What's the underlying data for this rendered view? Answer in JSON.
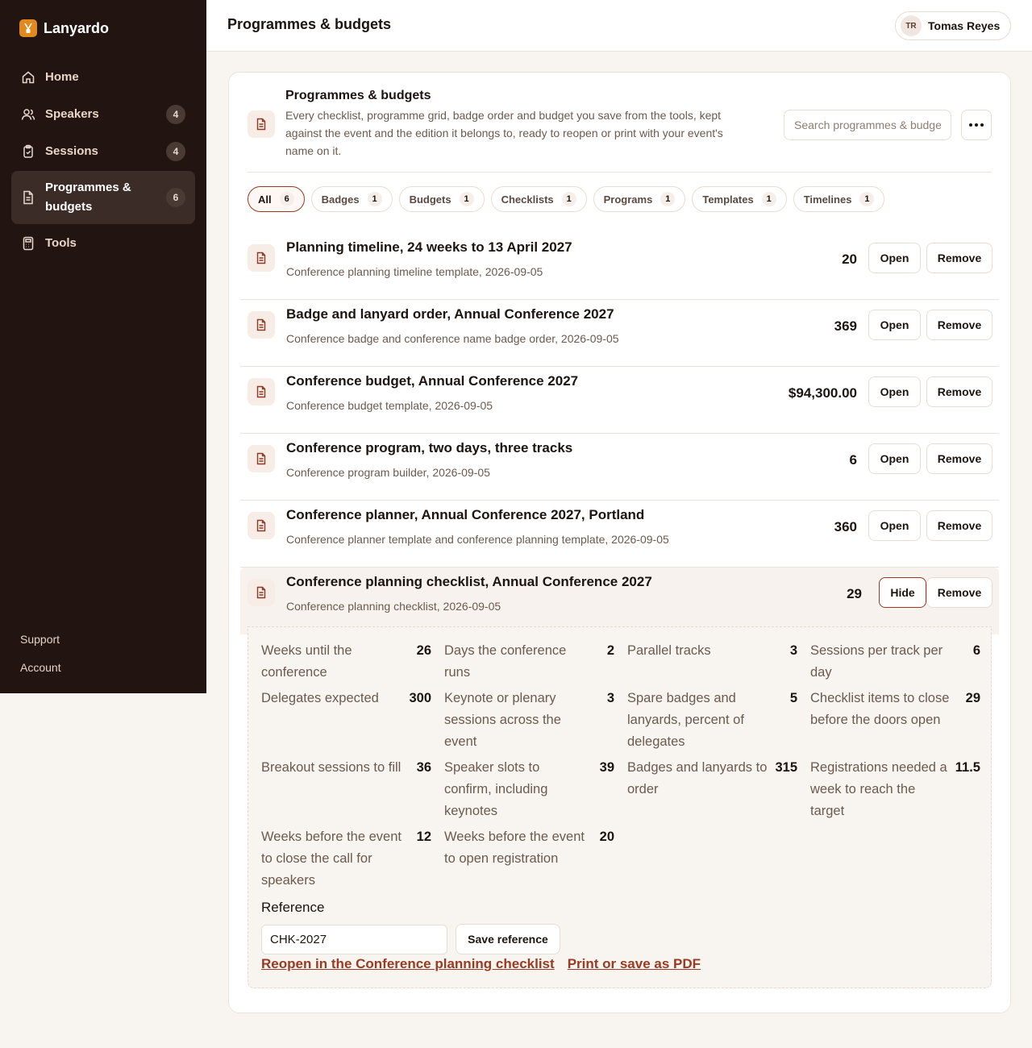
{
  "app": {
    "name": "Lanyardo"
  },
  "sidebar": {
    "items": [
      {
        "label": "Home",
        "icon": "home-icon"
      },
      {
        "label": "Speakers",
        "badge": "4",
        "icon": "users-icon"
      },
      {
        "label": "Sessions",
        "badge": "4",
        "icon": "clipboard-icon"
      },
      {
        "label": "Programmes & budgets",
        "badge": "6",
        "icon": "document-icon",
        "active": true
      },
      {
        "label": "Tools",
        "icon": "calculator-icon"
      }
    ],
    "footer": {
      "support": "Support",
      "account": "Account"
    }
  },
  "topbar": {
    "title": "Programmes & budgets",
    "user": {
      "initials": "TR",
      "name": "Tomas Reyes"
    }
  },
  "card": {
    "title": "Programmes & budgets",
    "description": "Every checklist, programme grid, badge order and budget you save from the tools, kept against the event and the edition it belongs to, ready to reopen or print with your event's name on it.",
    "search_placeholder": "Search programmes & budgets"
  },
  "filters": [
    {
      "label": "All",
      "count": "6",
      "active": true
    },
    {
      "label": "Badges",
      "count": "1"
    },
    {
      "label": "Budgets",
      "count": "1"
    },
    {
      "label": "Checklists",
      "count": "1"
    },
    {
      "label": "Programs",
      "count": "1"
    },
    {
      "label": "Templates",
      "count": "1"
    },
    {
      "label": "Timelines",
      "count": "1"
    }
  ],
  "rows": [
    {
      "title": "Planning timeline, 24 weeks to 13 April 2027",
      "subtitle": "Conference planning timeline template, 2026-09-05",
      "value": "20",
      "primary": "Open",
      "remove": "Remove"
    },
    {
      "title": "Badge and lanyard order, Annual Conference 2027",
      "subtitle": "Conference badge and conference name badge order, 2026-09-05",
      "value": "369",
      "primary": "Open",
      "remove": "Remove"
    },
    {
      "title": "Conference budget, Annual Conference 2027",
      "subtitle": "Conference budget template, 2026-09-05",
      "value": "$94,300.00",
      "primary": "Open",
      "remove": "Remove"
    },
    {
      "title": "Conference program, two days, three tracks",
      "subtitle": "Conference program builder, 2026-09-05",
      "value": "6",
      "primary": "Open",
      "remove": "Remove"
    },
    {
      "title": "Conference planner, Annual Conference 2027, Portland",
      "subtitle": "Conference planner template and conference planning template, 2026-09-05",
      "value": "360",
      "primary": "Open",
      "remove": "Remove"
    },
    {
      "title": "Conference planning checklist, Annual Conference 2027",
      "subtitle": "Conference planning checklist, 2026-09-05",
      "value": "29",
      "primary": "Hide",
      "remove": "Remove"
    }
  ],
  "detail": {
    "stats": [
      {
        "label": "Weeks until the conference",
        "value": "26"
      },
      {
        "label": "Days the conference runs",
        "value": "2"
      },
      {
        "label": "Parallel tracks",
        "value": "3"
      },
      {
        "label": "Sessions per track per day",
        "value": "6"
      },
      {
        "label": "Delegates expected",
        "value": "300"
      },
      {
        "label": "Keynote or plenary sessions across the event",
        "value": "3"
      },
      {
        "label": "Spare badges and lanyards, percent of delegates",
        "value": "5"
      },
      {
        "label": "Checklist items to close before the doors open",
        "value": "29"
      },
      {
        "label": "Breakout sessions to fill",
        "value": "36"
      },
      {
        "label": "Speaker slots to confirm, including keynotes",
        "value": "39"
      },
      {
        "label": "Badges and lanyards to order",
        "value": "315"
      },
      {
        "label": "Registrations needed a week to reach the target",
        "value": "11.5"
      },
      {
        "label": "Weeks before the event to close the call for speakers",
        "value": "12"
      },
      {
        "label": "Weeks before the event to open registration",
        "value": "20"
      }
    ],
    "reference_label": "Reference",
    "reference_value": "CHK-2027",
    "save_label": "Save reference",
    "reopen_link": "Reopen in the Conference planning checklist",
    "print_link": "Print or save as PDF"
  },
  "colors": {
    "accent": "#9b3a22",
    "sidebar_bg": "#221511",
    "brand": "#e1891d"
  }
}
